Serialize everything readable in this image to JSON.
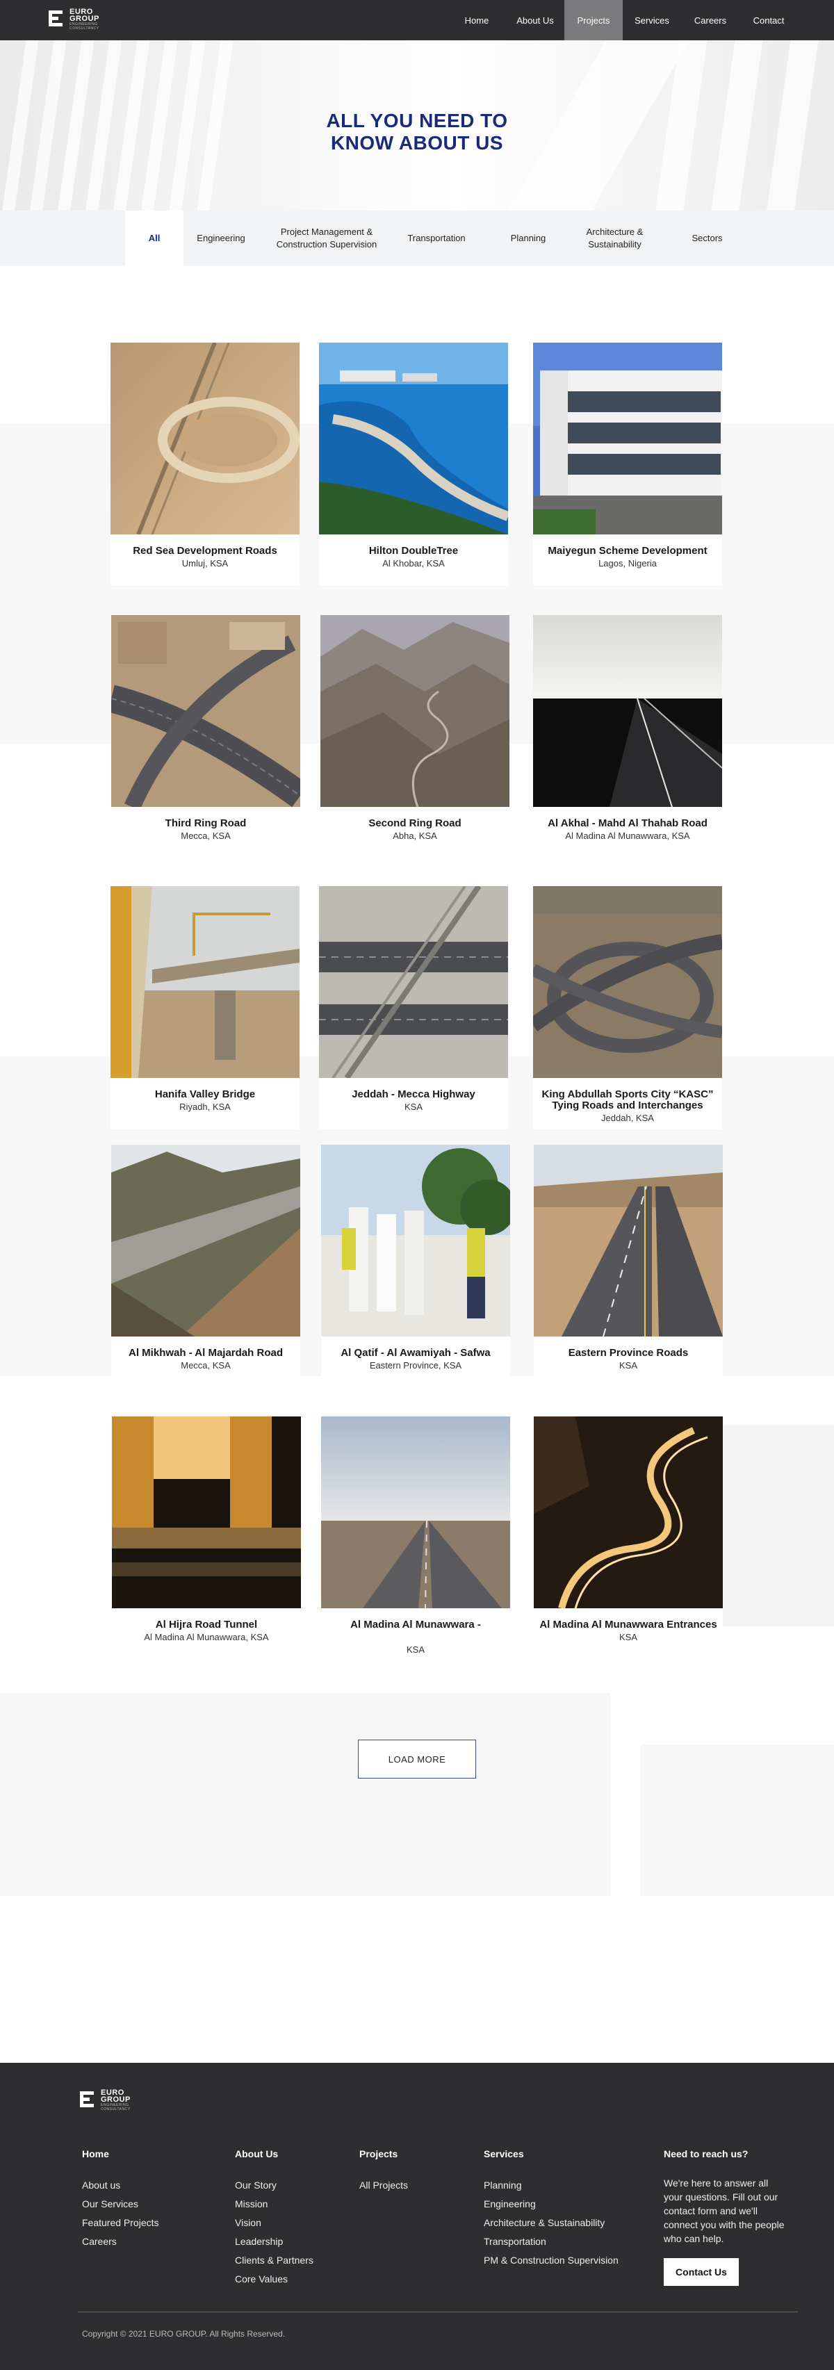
{
  "header": {
    "logo_line1": "EURO",
    "logo_line2": "GROUP",
    "logo_sub1": "ENGINEERING",
    "logo_sub2": "CONSULTANCY",
    "nav": [
      {
        "label": "Home"
      },
      {
        "label": "About Us"
      },
      {
        "label": "Projects",
        "active": true
      },
      {
        "label": "Services"
      },
      {
        "label": "Careers"
      },
      {
        "label": "Contact"
      }
    ]
  },
  "hero": {
    "title_line1": "ALL YOU NEED TO",
    "title_line2": "KNOW ABOUT US"
  },
  "filters": [
    {
      "label": "All",
      "active": true
    },
    {
      "label": "Engineering"
    },
    {
      "label": "Project Management & Construction Supervision"
    },
    {
      "label": "Transportation"
    },
    {
      "label": "Planning"
    },
    {
      "label": "Architecture & Sustainability"
    },
    {
      "label": "Sectors"
    }
  ],
  "projects": [
    {
      "title": "Red Sea Development Roads",
      "location": "Umluj, KSA",
      "image": "desert-road-aerial"
    },
    {
      "title": "Hilton DoubleTree",
      "location": "Al Khobar, KSA",
      "image": "coastal-resort"
    },
    {
      "title": "Maiyegun Scheme Development",
      "location": "Lagos, Nigeria",
      "image": "modern-building"
    },
    {
      "title": "Third Ring Road",
      "location": "Mecca, KSA",
      "image": "highway-interchange"
    },
    {
      "title": "Second Ring Road",
      "location": "Abha, KSA",
      "image": "mountain-road"
    },
    {
      "title": "Al Akhal - Mahd Al Thahab Road",
      "location": "Al Madina Al Munawwara, KSA",
      "image": "straight-road-sunset"
    },
    {
      "title": "Hanifa Valley Bridge",
      "location": "Riyadh, KSA",
      "image": "bridge-construction"
    },
    {
      "title": "Jeddah - Mecca Highway",
      "location": "KSA",
      "image": "highway-overpass"
    },
    {
      "title": "King Abdullah Sports City “KASC” Tying Roads and Interchanges",
      "location": "Jeddah, KSA",
      "image": "cloverleaf-interchange"
    },
    {
      "title": "Al Mikhwah - Al Majardah Road",
      "location": "Mecca, KSA",
      "image": "hillside-road"
    },
    {
      "title": "Al Qatif - Al Awamiyah - Safwa",
      "location": "Eastern Province, KSA",
      "image": "site-visit"
    },
    {
      "title": "Eastern Province Roads",
      "location": "KSA",
      "image": "dual-carriageway"
    },
    {
      "title": "Al Hijra Road Tunnel",
      "location": "Al Madina Al Munawwara, KSA",
      "image": "tunnel-night"
    },
    {
      "title": "Al Madina Al Munawwara -",
      "location": "KSA",
      "image": "long-highway"
    },
    {
      "title": "Al Madina Al Munawwara Entrances",
      "location": "KSA",
      "image": "winding-road-night"
    }
  ],
  "load_more_label": "LOAD MORE",
  "footer": {
    "home": {
      "heading": "Home",
      "links": [
        "About us",
        "Our Services",
        "Featured Projects",
        "Careers"
      ]
    },
    "about": {
      "heading": "About Us",
      "links": [
        "Our Story",
        "Mission",
        "Vision",
        "Leadership",
        "Clients & Partners",
        "Core Values"
      ]
    },
    "projects": {
      "heading": "Projects",
      "links": [
        "All Projects"
      ]
    },
    "services": {
      "heading": "Services",
      "links": [
        "Planning",
        "Engineering",
        "Architecture & Sustainability",
        "Transportation",
        "PM & Construction Supervision"
      ]
    },
    "contact": {
      "heading": "Need to reach us?",
      "text": "We're here to answer all your questions. Fill out our contact form and we'll connect you with the people who can help.",
      "button": "Contact Us"
    },
    "copyright": "Copyright © 2021 EURO GROUP. All Rights Reserved."
  },
  "colors": {
    "header_bg": "#2e2e30",
    "accent": "#1a2a7a",
    "active_nav": "#7a7a7c"
  }
}
